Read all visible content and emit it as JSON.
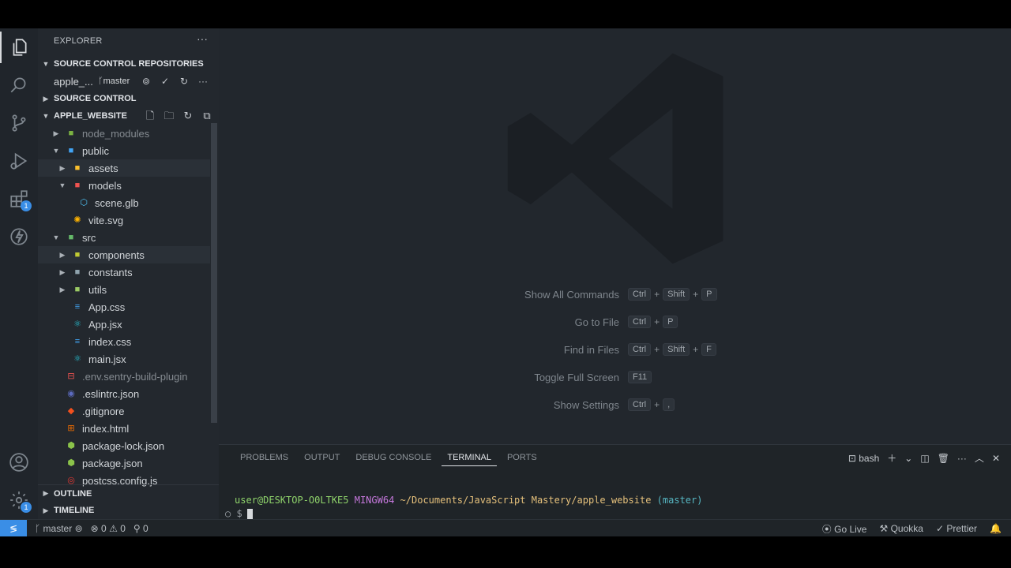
{
  "explorer": {
    "title": "EXPLORER",
    "more": "···",
    "sections": {
      "source_control_repositories": "SOURCE CONTROL REPOSITORIES",
      "source_control": "SOURCE CONTROL",
      "project": "APPLE_WEBSITE",
      "outline": "OUTLINE",
      "timeline": "TIMELINE"
    },
    "repo": {
      "name": "apple_...",
      "branch": "master"
    },
    "tree": [
      {
        "label": "node_modules",
        "depth": 1,
        "type": "folder",
        "expanded": false,
        "dim": true,
        "icon_color": "#7cb342"
      },
      {
        "label": "public",
        "depth": 1,
        "type": "folder",
        "expanded": true,
        "icon_color": "#42a5f5"
      },
      {
        "label": "assets",
        "depth": 2,
        "type": "folder",
        "expanded": false,
        "icon_color": "#fbc02d",
        "highlight": true
      },
      {
        "label": "models",
        "depth": 2,
        "type": "folder",
        "expanded": true,
        "icon_color": "#ef5350"
      },
      {
        "label": "scene.glb",
        "depth": 3,
        "type": "file",
        "icon": "cube",
        "icon_color": "#4fc3f7"
      },
      {
        "label": "vite.svg",
        "depth": 2,
        "type": "file",
        "icon": "star",
        "icon_color": "#ffb300"
      },
      {
        "label": "src",
        "depth": 1,
        "type": "folder",
        "expanded": true,
        "icon_color": "#66bb6a"
      },
      {
        "label": "components",
        "depth": 2,
        "type": "folder",
        "expanded": false,
        "icon_color": "#c0ca33",
        "highlight": true
      },
      {
        "label": "constants",
        "depth": 2,
        "type": "folder",
        "expanded": false,
        "icon_color": "#90a4ae"
      },
      {
        "label": "utils",
        "depth": 2,
        "type": "folder",
        "expanded": false,
        "icon_color": "#9ccc65"
      },
      {
        "label": "App.css",
        "depth": 2,
        "type": "file",
        "icon": "css",
        "icon_color": "#42a5f5"
      },
      {
        "label": "App.jsx",
        "depth": 2,
        "type": "file",
        "icon": "react",
        "icon_color": "#26c6da"
      },
      {
        "label": "index.css",
        "depth": 2,
        "type": "file",
        "icon": "css",
        "icon_color": "#42a5f5"
      },
      {
        "label": "main.jsx",
        "depth": 2,
        "type": "file",
        "icon": "react",
        "icon_color": "#26c6da"
      },
      {
        "label": ".env.sentry-build-plugin",
        "depth": 1,
        "type": "file",
        "icon": "env",
        "icon_color": "#ef5350",
        "dim": true
      },
      {
        "label": ".eslintrc.json",
        "depth": 1,
        "type": "file",
        "icon": "eslint",
        "icon_color": "#5c6bc0"
      },
      {
        "label": ".gitignore",
        "depth": 1,
        "type": "file",
        "icon": "git",
        "icon_color": "#f4511e"
      },
      {
        "label": "index.html",
        "depth": 1,
        "type": "file",
        "icon": "html",
        "icon_color": "#ef6c00"
      },
      {
        "label": "package-lock.json",
        "depth": 1,
        "type": "file",
        "icon": "node",
        "icon_color": "#8bc34a"
      },
      {
        "label": "package.json",
        "depth": 1,
        "type": "file",
        "icon": "node",
        "icon_color": "#8bc34a"
      },
      {
        "label": "postcss.config.js",
        "depth": 1,
        "type": "file",
        "icon": "postcss",
        "icon_color": "#e53935"
      }
    ]
  },
  "activity": {
    "extensions_badge": "1",
    "settings_badge": "1"
  },
  "editor": {
    "hints": [
      {
        "label": "Show All Commands",
        "keys": [
          "Ctrl",
          "Shift",
          "P"
        ]
      },
      {
        "label": "Go to File",
        "keys": [
          "Ctrl",
          "P"
        ]
      },
      {
        "label": "Find in Files",
        "keys": [
          "Ctrl",
          "Shift",
          "F"
        ]
      },
      {
        "label": "Toggle Full Screen",
        "keys": [
          "F11"
        ]
      },
      {
        "label": "Show Settings",
        "keys": [
          "Ctrl",
          ","
        ]
      }
    ]
  },
  "panel": {
    "tabs": [
      "PROBLEMS",
      "OUTPUT",
      "DEBUG CONSOLE",
      "TERMINAL",
      "PORTS"
    ],
    "active_tab": "TERMINAL",
    "shell": "bash",
    "terminal": {
      "user_host": "user@DESKTOP-O0LTKE5",
      "system": "MINGW64",
      "path": "~/Documents/JavaScript Mastery/apple_website",
      "branch": "(master)",
      "prompt": "$"
    }
  },
  "status": {
    "branch": "master",
    "errors": "0",
    "warnings": "0",
    "ports": "0",
    "go_live": "Go Live",
    "quokka": "Quokka",
    "prettier": "Prettier"
  }
}
